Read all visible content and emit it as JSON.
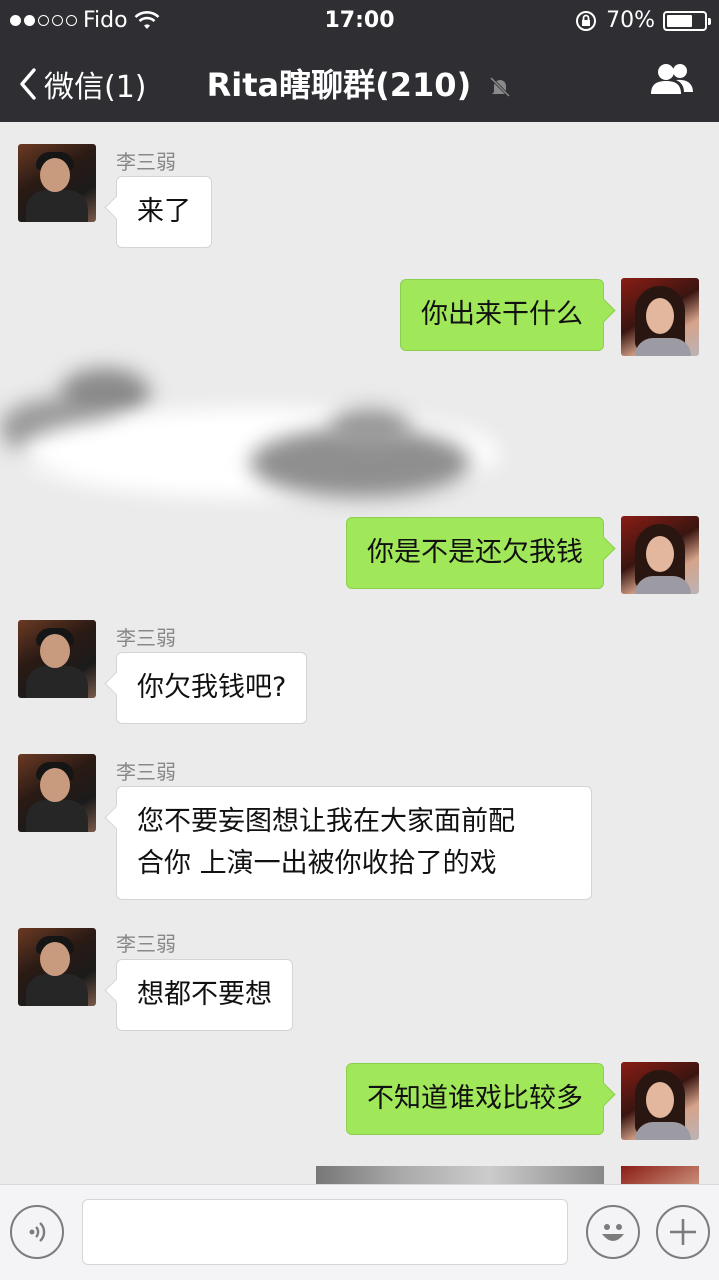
{
  "status_bar": {
    "carrier": "Fido",
    "time": "17:00",
    "battery": "70%",
    "battery_level": 0.7,
    "signal_bars_filled": 2,
    "signal_bars_total": 5
  },
  "nav": {
    "back_label": "微信(1)",
    "title": "Rita瞎聊群(210)",
    "muted": true
  },
  "messages": [
    {
      "side": "left",
      "sender": "李三弱",
      "text": "来了"
    },
    {
      "side": "right",
      "text": "你出来干什么"
    },
    {
      "side": "right",
      "text": "你是不是还欠我钱"
    },
    {
      "side": "left",
      "sender": "李三弱",
      "text": "你欠我钱吧?"
    },
    {
      "side": "left",
      "sender": "李三弱",
      "lines": [
        "您不要妄图想让我在大家面前配",
        "合你 上演一出被你收拾了的戏"
      ]
    },
    {
      "side": "left",
      "sender": "李三弱",
      "text": "想都不要想"
    },
    {
      "side": "right",
      "text": "不知道谁戏比较多"
    }
  ],
  "input_bar": {
    "placeholder": ""
  },
  "colors": {
    "nav_bg": "#2e2e33",
    "chat_bg": "#ebebeb",
    "my_bubble": "#a0e75a",
    "their_bubble": "#ffffff"
  },
  "icons": [
    "wifi-icon",
    "rotation-lock-icon",
    "battery-icon",
    "back-chevron-icon",
    "mute-bell-icon",
    "group-members-icon",
    "voice-icon",
    "emoji-icon",
    "plus-icon"
  ]
}
